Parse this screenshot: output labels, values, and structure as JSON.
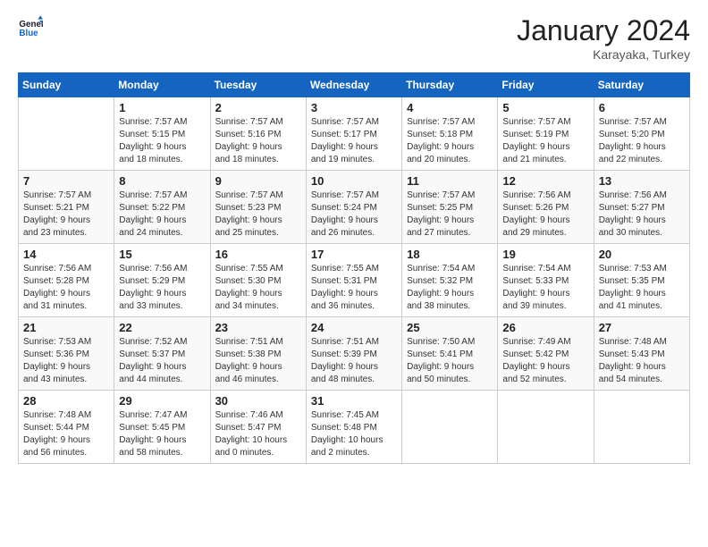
{
  "logo": {
    "line1": "General",
    "line2": "Blue"
  },
  "title": "January 2024",
  "location": "Karayaka, Turkey",
  "days_of_week": [
    "Sunday",
    "Monday",
    "Tuesday",
    "Wednesday",
    "Thursday",
    "Friday",
    "Saturday"
  ],
  "weeks": [
    [
      {
        "day": "",
        "content": ""
      },
      {
        "day": "1",
        "content": "Sunrise: 7:57 AM\nSunset: 5:15 PM\nDaylight: 9 hours\nand 18 minutes."
      },
      {
        "day": "2",
        "content": "Sunrise: 7:57 AM\nSunset: 5:16 PM\nDaylight: 9 hours\nand 18 minutes."
      },
      {
        "day": "3",
        "content": "Sunrise: 7:57 AM\nSunset: 5:17 PM\nDaylight: 9 hours\nand 19 minutes."
      },
      {
        "day": "4",
        "content": "Sunrise: 7:57 AM\nSunset: 5:18 PM\nDaylight: 9 hours\nand 20 minutes."
      },
      {
        "day": "5",
        "content": "Sunrise: 7:57 AM\nSunset: 5:19 PM\nDaylight: 9 hours\nand 21 minutes."
      },
      {
        "day": "6",
        "content": "Sunrise: 7:57 AM\nSunset: 5:20 PM\nDaylight: 9 hours\nand 22 minutes."
      }
    ],
    [
      {
        "day": "7",
        "content": "Sunrise: 7:57 AM\nSunset: 5:21 PM\nDaylight: 9 hours\nand 23 minutes."
      },
      {
        "day": "8",
        "content": "Sunrise: 7:57 AM\nSunset: 5:22 PM\nDaylight: 9 hours\nand 24 minutes."
      },
      {
        "day": "9",
        "content": "Sunrise: 7:57 AM\nSunset: 5:23 PM\nDaylight: 9 hours\nand 25 minutes."
      },
      {
        "day": "10",
        "content": "Sunrise: 7:57 AM\nSunset: 5:24 PM\nDaylight: 9 hours\nand 26 minutes."
      },
      {
        "day": "11",
        "content": "Sunrise: 7:57 AM\nSunset: 5:25 PM\nDaylight: 9 hours\nand 27 minutes."
      },
      {
        "day": "12",
        "content": "Sunrise: 7:56 AM\nSunset: 5:26 PM\nDaylight: 9 hours\nand 29 minutes."
      },
      {
        "day": "13",
        "content": "Sunrise: 7:56 AM\nSunset: 5:27 PM\nDaylight: 9 hours\nand 30 minutes."
      }
    ],
    [
      {
        "day": "14",
        "content": "Sunrise: 7:56 AM\nSunset: 5:28 PM\nDaylight: 9 hours\nand 31 minutes."
      },
      {
        "day": "15",
        "content": "Sunrise: 7:56 AM\nSunset: 5:29 PM\nDaylight: 9 hours\nand 33 minutes."
      },
      {
        "day": "16",
        "content": "Sunrise: 7:55 AM\nSunset: 5:30 PM\nDaylight: 9 hours\nand 34 minutes."
      },
      {
        "day": "17",
        "content": "Sunrise: 7:55 AM\nSunset: 5:31 PM\nDaylight: 9 hours\nand 36 minutes."
      },
      {
        "day": "18",
        "content": "Sunrise: 7:54 AM\nSunset: 5:32 PM\nDaylight: 9 hours\nand 38 minutes."
      },
      {
        "day": "19",
        "content": "Sunrise: 7:54 AM\nSunset: 5:33 PM\nDaylight: 9 hours\nand 39 minutes."
      },
      {
        "day": "20",
        "content": "Sunrise: 7:53 AM\nSunset: 5:35 PM\nDaylight: 9 hours\nand 41 minutes."
      }
    ],
    [
      {
        "day": "21",
        "content": "Sunrise: 7:53 AM\nSunset: 5:36 PM\nDaylight: 9 hours\nand 43 minutes."
      },
      {
        "day": "22",
        "content": "Sunrise: 7:52 AM\nSunset: 5:37 PM\nDaylight: 9 hours\nand 44 minutes."
      },
      {
        "day": "23",
        "content": "Sunrise: 7:51 AM\nSunset: 5:38 PM\nDaylight: 9 hours\nand 46 minutes."
      },
      {
        "day": "24",
        "content": "Sunrise: 7:51 AM\nSunset: 5:39 PM\nDaylight: 9 hours\nand 48 minutes."
      },
      {
        "day": "25",
        "content": "Sunrise: 7:50 AM\nSunset: 5:41 PM\nDaylight: 9 hours\nand 50 minutes."
      },
      {
        "day": "26",
        "content": "Sunrise: 7:49 AM\nSunset: 5:42 PM\nDaylight: 9 hours\nand 52 minutes."
      },
      {
        "day": "27",
        "content": "Sunrise: 7:48 AM\nSunset: 5:43 PM\nDaylight: 9 hours\nand 54 minutes."
      }
    ],
    [
      {
        "day": "28",
        "content": "Sunrise: 7:48 AM\nSunset: 5:44 PM\nDaylight: 9 hours\nand 56 minutes."
      },
      {
        "day": "29",
        "content": "Sunrise: 7:47 AM\nSunset: 5:45 PM\nDaylight: 9 hours\nand 58 minutes."
      },
      {
        "day": "30",
        "content": "Sunrise: 7:46 AM\nSunset: 5:47 PM\nDaylight: 10 hours\nand 0 minutes."
      },
      {
        "day": "31",
        "content": "Sunrise: 7:45 AM\nSunset: 5:48 PM\nDaylight: 10 hours\nand 2 minutes."
      },
      {
        "day": "",
        "content": ""
      },
      {
        "day": "",
        "content": ""
      },
      {
        "day": "",
        "content": ""
      }
    ]
  ]
}
